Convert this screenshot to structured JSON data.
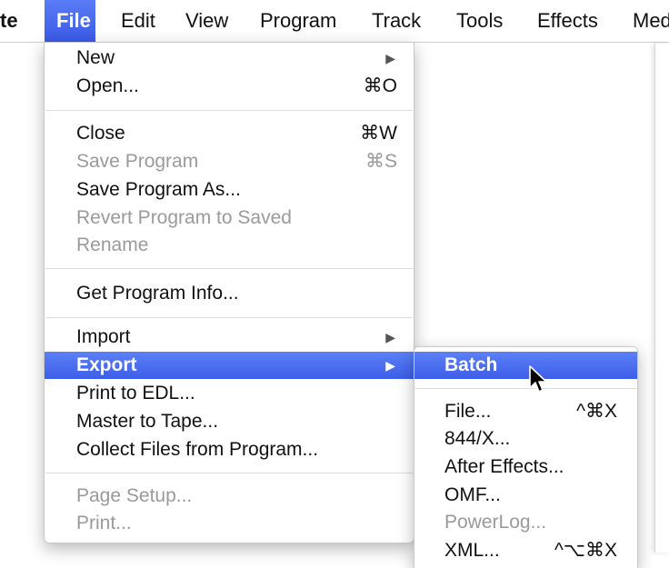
{
  "menubar": {
    "items": [
      "te",
      "File",
      "Edit",
      "View",
      "Program",
      "Track",
      "Tools",
      "Effects",
      "Med"
    ]
  },
  "file_menu": {
    "items": [
      {
        "label": "New",
        "submenu": true
      },
      {
        "label": "Open...",
        "shortcut": "⌘O"
      },
      {
        "label": "Close",
        "shortcut": "⌘W"
      },
      {
        "label": "Save Program",
        "shortcut": "⌘S",
        "disabled": true
      },
      {
        "label": "Save Program As..."
      },
      {
        "label": "Revert Program to Saved",
        "disabled": true
      },
      {
        "label": "Rename",
        "disabled": true
      },
      {
        "label": "Get Program Info..."
      },
      {
        "label": "Import",
        "submenu": true
      },
      {
        "label": "Export",
        "submenu": true,
        "highlighted": true
      },
      {
        "label": "Print to EDL..."
      },
      {
        "label": "Master to Tape..."
      },
      {
        "label": "Collect Files from Program..."
      },
      {
        "label": "Page Setup...",
        "disabled": true
      },
      {
        "label": "Print...",
        "disabled": true
      }
    ]
  },
  "export_menu": {
    "items": [
      {
        "label": "Batch",
        "highlighted": true
      },
      {
        "label": "File...",
        "shortcut": "^⌘X"
      },
      {
        "label": "844/X..."
      },
      {
        "label": "After Effects..."
      },
      {
        "label": "OMF..."
      },
      {
        "label": "PowerLog...",
        "disabled": true
      },
      {
        "label": "XML...",
        "shortcut": "^⌥⌘X"
      }
    ]
  },
  "icons": {
    "submenu_arrow": "▶",
    "cursor": "arrow-cursor-icon"
  },
  "colors": {
    "highlight": "#4a6cf0",
    "disabled_text": "#9a9a9a"
  }
}
